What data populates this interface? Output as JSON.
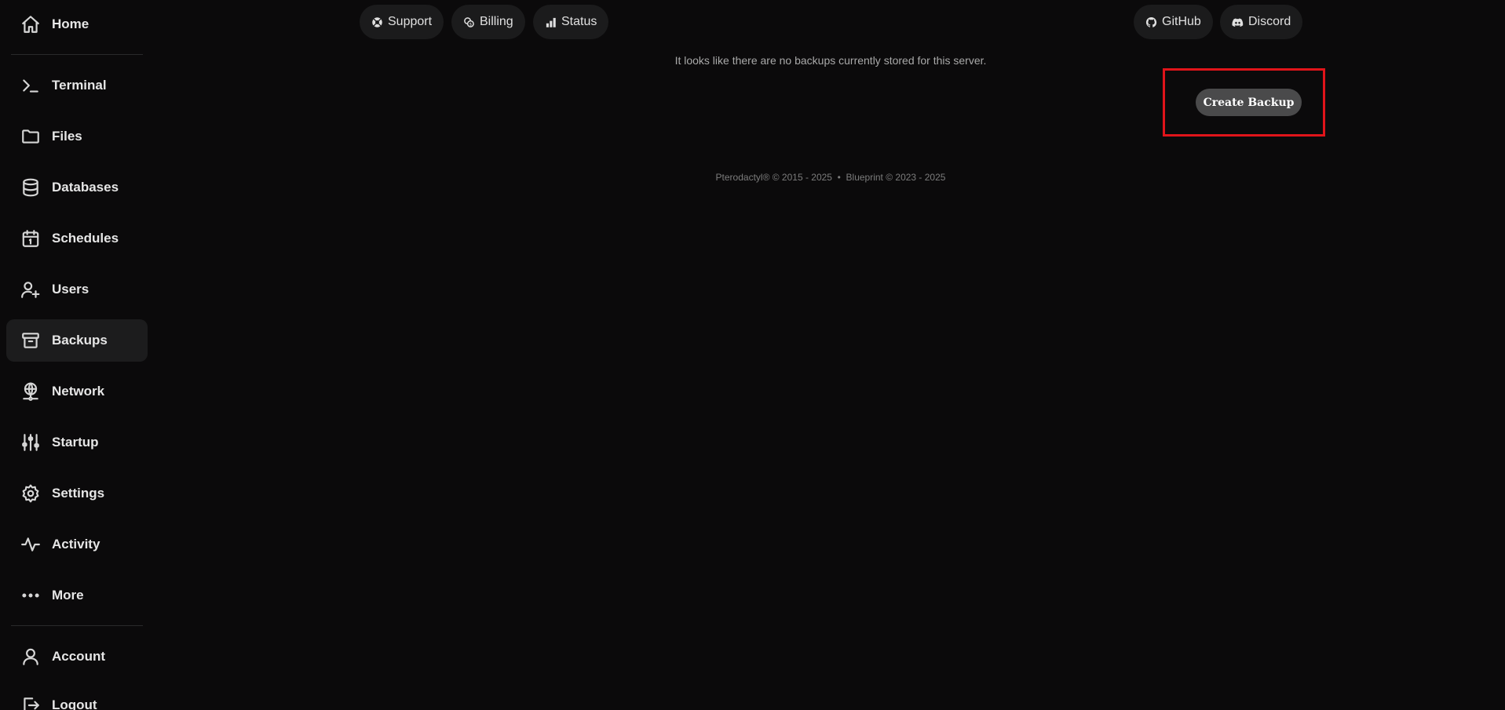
{
  "sidebar": {
    "items": [
      {
        "label": "Home",
        "icon": "home-icon"
      },
      {
        "label": "Terminal",
        "icon": "terminal-icon"
      },
      {
        "label": "Files",
        "icon": "folder-icon"
      },
      {
        "label": "Databases",
        "icon": "database-icon"
      },
      {
        "label": "Schedules",
        "icon": "calendar-icon"
      },
      {
        "label": "Users",
        "icon": "user-plus-icon"
      },
      {
        "label": "Backups",
        "icon": "archive-icon",
        "active": true
      },
      {
        "label": "Network",
        "icon": "network-icon"
      },
      {
        "label": "Startup",
        "icon": "sliders-icon"
      },
      {
        "label": "Settings",
        "icon": "gear-icon"
      },
      {
        "label": "Activity",
        "icon": "activity-icon"
      },
      {
        "label": "More",
        "icon": "more-dots-icon"
      },
      {
        "label": "Account",
        "icon": "user-icon"
      },
      {
        "label": "Logout",
        "icon": "logout-icon"
      }
    ]
  },
  "topbar": {
    "support": "Support",
    "billing": "Billing",
    "status": "Status",
    "github": "GitHub",
    "discord": "Discord"
  },
  "main": {
    "empty_message": "It looks like there are no backups currently stored for this server.",
    "create_button": "Create Backup"
  },
  "footer": {
    "text": "Pterodactyl® © 2015 - 2025  •  Blueprint © 2023 - 2025"
  },
  "colors": {
    "background": "#0b0a0b",
    "active_item": "#1c1c1d",
    "highlight": "#e0141a",
    "button": "#4a4a4b"
  }
}
